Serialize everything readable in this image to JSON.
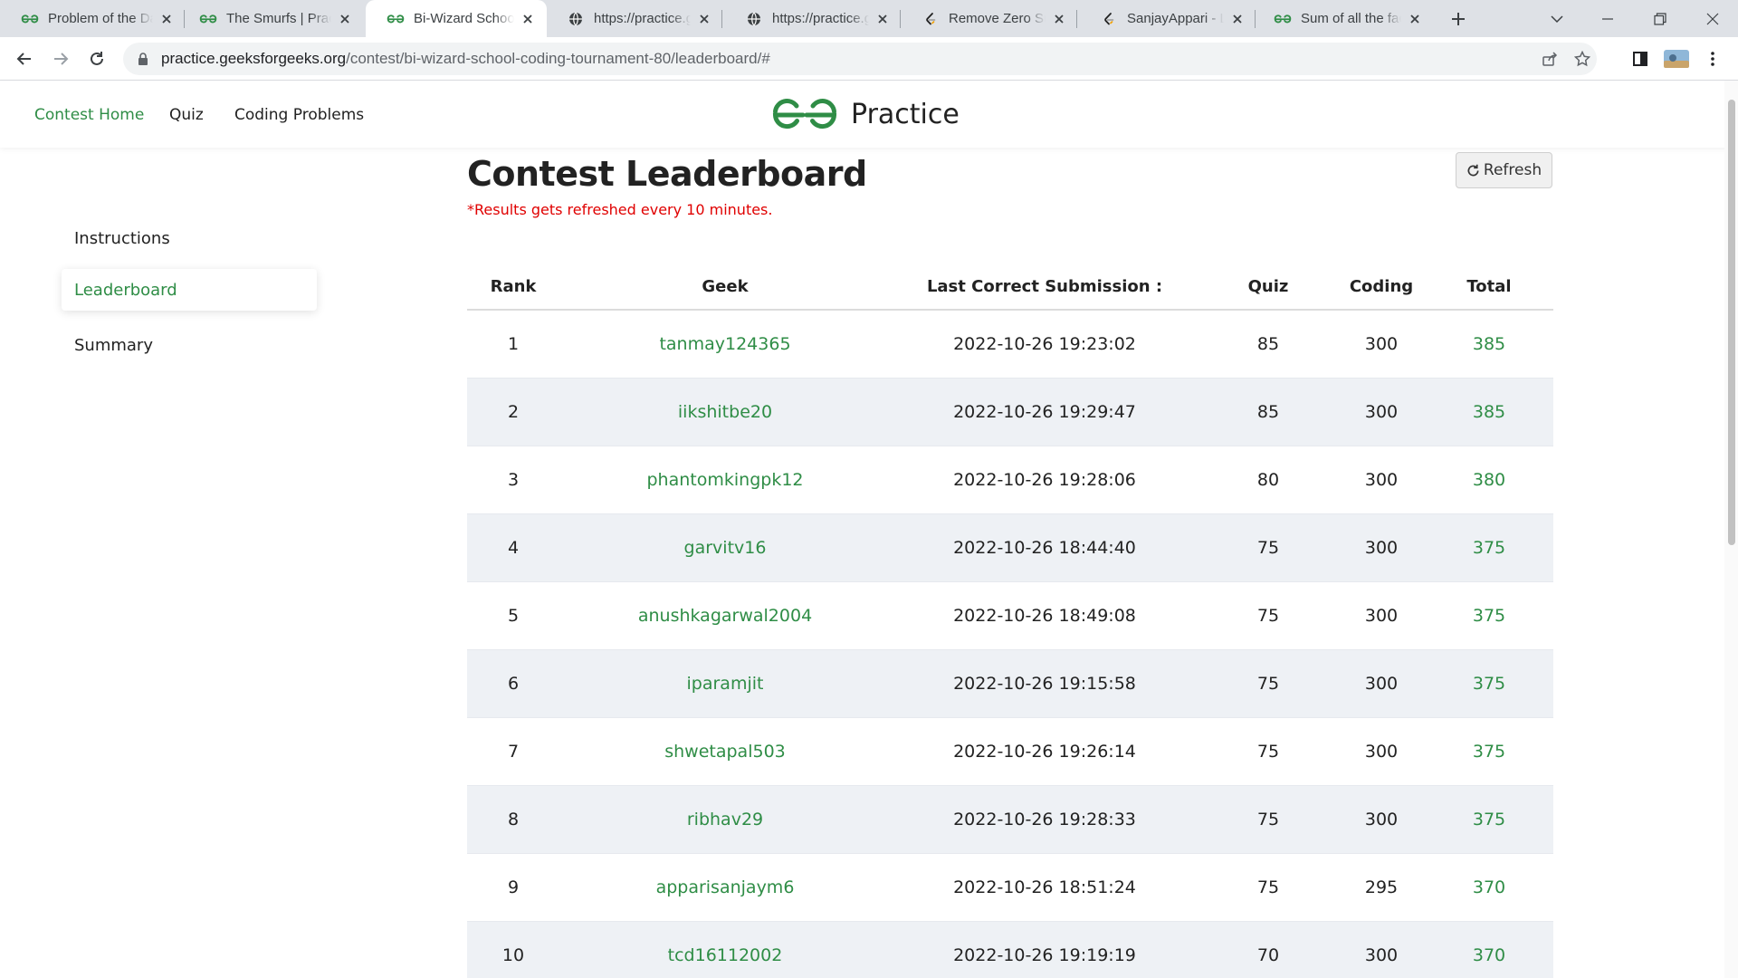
{
  "browser": {
    "tabs": [
      {
        "title": "Problem of the Day",
        "favicon": "gfg-icon"
      },
      {
        "title": "The Smurfs | Practice",
        "favicon": "gfg-icon"
      },
      {
        "title": "Bi-Wizard School Coding",
        "favicon": "gfg-icon",
        "active": true
      },
      {
        "title": "https://practice.geeksforgeeks.org",
        "favicon": "globe-icon"
      },
      {
        "title": "https://practice.geeksforgeeks.org",
        "favicon": "globe-icon"
      },
      {
        "title": "Remove Zero Sum",
        "favicon": "leetcode-icon"
      },
      {
        "title": "SanjayAppari - LeetCode",
        "favicon": "leetcode-icon"
      },
      {
        "title": "Sum of all the factors",
        "favicon": "gfg-icon"
      }
    ],
    "url_host": "practice.geeksforgeeks.org",
    "url_path": "/contest/bi-wizard-school-coding-tournament-80/leaderboard/#"
  },
  "header": {
    "nav": [
      "Contest Home",
      "Quiz",
      "Coding Problems"
    ],
    "logo_text": "Practice",
    "brand_color": "#2f8d46"
  },
  "sidebar": {
    "items": [
      {
        "label": "Instructions"
      },
      {
        "label": "Leaderboard",
        "active": true
      },
      {
        "label": "Summary"
      }
    ]
  },
  "main": {
    "title": "Contest Leaderboard",
    "note": "*Results gets refreshed every 10 minutes.",
    "refresh_label": "Refresh"
  },
  "leaderboard": {
    "columns": [
      "Rank",
      "Geek",
      "Last Correct Submission :",
      "Quiz",
      "Coding",
      "Total"
    ],
    "rows": [
      [
        "1",
        "tanmay124365",
        "2022-10-26 19:23:02",
        "85",
        "300",
        "385"
      ],
      [
        "2",
        "iikshitbe20",
        "2022-10-26 19:29:47",
        "85",
        "300",
        "385"
      ],
      [
        "3",
        "phantomkingpk12",
        "2022-10-26 19:28:06",
        "80",
        "300",
        "380"
      ],
      [
        "4",
        "garvitv16",
        "2022-10-26 18:44:40",
        "75",
        "300",
        "375"
      ],
      [
        "5",
        "anushkagarwal2004",
        "2022-10-26 18:49:08",
        "75",
        "300",
        "375"
      ],
      [
        "6",
        "iparamjit",
        "2022-10-26 19:15:58",
        "75",
        "300",
        "375"
      ],
      [
        "7",
        "shwetapal503",
        "2022-10-26 19:26:14",
        "75",
        "300",
        "375"
      ],
      [
        "8",
        "ribhav29",
        "2022-10-26 19:28:33",
        "75",
        "300",
        "375"
      ],
      [
        "9",
        "apparisanjaym6",
        "2022-10-26 18:51:24",
        "75",
        "295",
        "370"
      ],
      [
        "10",
        "tcd16112002",
        "2022-10-26 19:19:19",
        "70",
        "300",
        "370"
      ]
    ]
  }
}
